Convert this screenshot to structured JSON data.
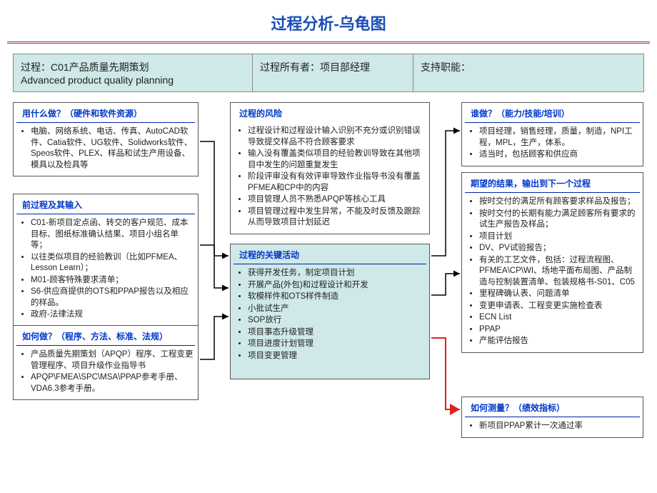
{
  "title": "过程分析-乌龟图",
  "header": {
    "c1_line1": "过程：C01产品质量先期策划",
    "c1_line2": "Advanced product quality planning",
    "c2": "过程所有者：项目部经理",
    "c3": "支持职能："
  },
  "boxes": {
    "resources": {
      "title": "用什么做？（硬件和软件资源）",
      "items": [
        "电脑、网络系统、电话、传真、AutoCAD软件、Catia软件、UG软件、Solidworks软件、Speos软件、PLEX、样品和试生产用设备、模具以及检具等"
      ]
    },
    "inputs": {
      "title": "前过程及其输入",
      "items": [
        "C01-新项目定点函、转交的客户规范、成本目标、图纸标准确认结果、项目小组名单等；",
        "以往类似项目的经验教训（比如PFMEA、Lesson Learn）；",
        "M01-顾客特殊要求清单；",
        "S6-供应商提供的OTS和PPAP报告以及相应的样品。",
        "政府-法律法规"
      ]
    },
    "how": {
      "title": "如何做？（程序、方法、标准、法规）",
      "items": [
        "产品质量先期策划（APQP）程序、工程变更管理程序、项目升级作业指导书",
        "APQP\\FMEA\\SPC\\MSA\\PPAP参考手册、VDA6.3参考手册。"
      ]
    },
    "risk": {
      "title": "过程的风险",
      "items": [
        "过程设计和过程设计输入识别不充分或识别错误导致提交样品不符合顾客要求",
        "输入没有覆盖类似项目的经验教训导致在其他项目中发生的问题重复发生",
        "阶段评审没有有效评审导致作业指导书没有覆盖PFMEA和CP中的内容",
        "项目管理人员不熟悉APQP等核心工具",
        "项目管理过程中发生异常，不能及时反馈及跟踪从而导致项目计划延迟"
      ]
    },
    "key": {
      "title": "过程的关键活动",
      "items": [
        "获得开发任务，制定项目计划",
        "开展产品(外包)和过程设计和开发",
        "软模样件和OTS样件制造",
        "小批试生产",
        "SOP放行",
        "项目事态升级管理",
        "项目进度计划管理",
        "项目变更管理"
      ]
    },
    "who": {
      "title": "谁做？（能力/技能/培训）",
      "items": [
        "项目经理，销售经理，质量，制造，NPI工程，MPL，生产，体系。",
        "适当时，包括顾客和供应商"
      ]
    },
    "output": {
      "title": "期望的结果，输出到下一个过程",
      "items": [
        "按时交付的满足所有顾客要求样品及报告；",
        "按时交付的长期有能力满足顾客所有要求的试生产报告及样品；",
        "项目计划",
        "DV、PV试验报告；",
        "有关的工艺文件，包括：过程流程图、PFMEA\\CP\\WI、场地平面布局图、产品制造与控制装置清单、包装规格书-S01、C05",
        "里程碑确认表、问题清单",
        "变更申请表、工程变更实施检查表",
        "ECN List",
        "PPAP",
        "产能评估报告"
      ]
    },
    "measure": {
      "title": "如何测量？（绩效指标）",
      "items": [
        "新项目PPAP累计一次通过率"
      ]
    }
  }
}
